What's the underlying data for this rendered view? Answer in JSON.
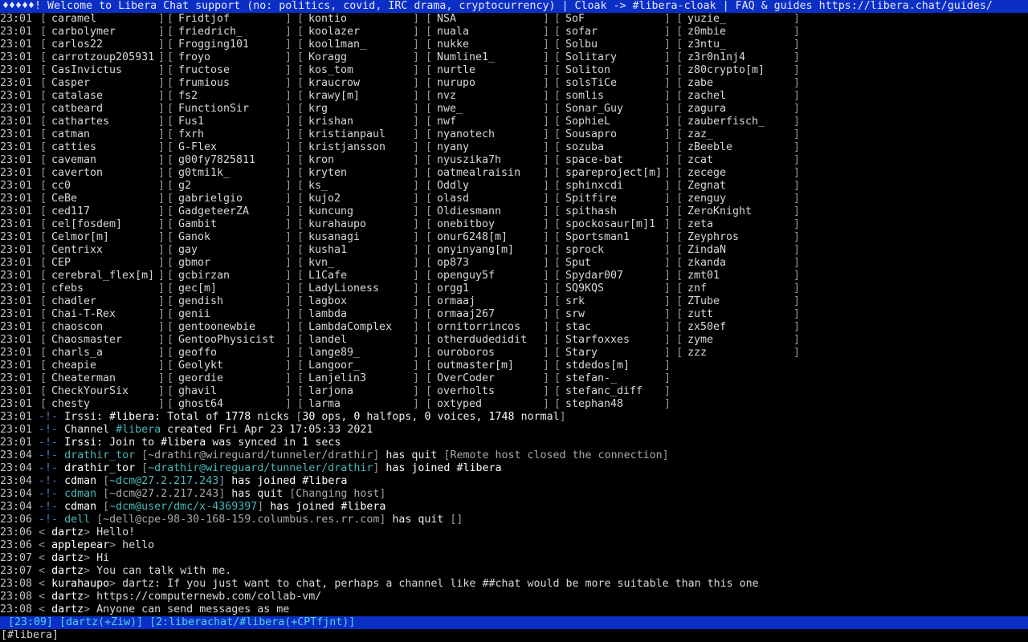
{
  "topic": "♦♦♦♦♦! Welcome to Libera Chat support (no: politics, covid, IRC drama, cryptocurrency) | Cloak -> #libera-cloak | FAQ & guides https://libera.chat/guides/",
  "names_timestamp": "23:01",
  "names": [
    [
      "caramel",
      "Fridtjof",
      "kontio",
      "NSA",
      "SoF",
      "yuzie_"
    ],
    [
      "carbolymer",
      "friedrich_",
      "koolazer",
      "nuala",
      "sofar",
      "z0mbie"
    ],
    [
      "carlos22",
      "Frogging101",
      "kool1man_",
      "nukke",
      "Solbu",
      "z3ntu_"
    ],
    [
      "carrotzoup205931",
      "froyo",
      "Koragg",
      "Numline1_",
      "Solitary",
      "z3r0n1nj4"
    ],
    [
      "CasInvictus",
      "fructose",
      "kos_tom",
      "nurtle",
      "Soliton",
      "z80crypto[m]"
    ],
    [
      "Casper",
      "frumious",
      "kraucrow",
      "nurupo",
      "solsTiCe",
      "zabe"
    ],
    [
      "catalase",
      "fs2",
      "krawy[m]",
      "nvz",
      "somlis",
      "zachel"
    ],
    [
      "catbeard",
      "FunctionSir",
      "krg",
      "nwe_",
      "Sonar_Guy",
      "zagura"
    ],
    [
      "cathartes",
      "Fus1",
      "krishan",
      "nwf",
      "SophieL",
      "zauberfisch_"
    ],
    [
      "catman",
      "fxrh",
      "kristianpaul",
      "nyanotech",
      "Sousapro",
      "zaz_"
    ],
    [
      "catties",
      "G-Flex",
      "kristjansson",
      "nyany",
      "sozuba",
      "zBeeble"
    ],
    [
      "caveman",
      "g00fy7825811",
      "kron",
      "nyuszika7h",
      "space-bat",
      "zcat"
    ],
    [
      "caverton",
      "g0tmi1k_",
      "kryten",
      "oatmealraisin",
      "spareproject[m]",
      "zecege"
    ],
    [
      "cc0",
      "g2",
      "ks_",
      "Oddly",
      "sphinxcdi",
      "Zegnat"
    ],
    [
      "CeBe",
      "gabrielgio",
      "kujo2",
      "olasd",
      "Spitfire",
      "zenguy"
    ],
    [
      "ced117",
      "GadgeteerZA",
      "kuncung",
      "Oldiesmann",
      "spithash",
      "ZeroKnight"
    ],
    [
      "cel[fosdem]",
      "Gambit",
      "kurahaupo",
      "onebitboy",
      "spockosaur[m]1",
      "zeta"
    ],
    [
      "Celmor[m]",
      "Ganok",
      "kusanagi",
      "onur6248[m]",
      "Sportsman1",
      "Zeyphros"
    ],
    [
      "Centrixx",
      "gay",
      "kusha1",
      "onyinyang[m]",
      "sprock",
      "ZindaN"
    ],
    [
      "CEP",
      "gbmor",
      "kvn_",
      "op873",
      "Sput",
      "zkanda"
    ],
    [
      "cerebral_flex[m]",
      "gcbirzan",
      "L1Cafe",
      "openguy5f",
      "Spydar007",
      "zmt01"
    ],
    [
      "cfebs",
      "gec[m]",
      "LadyLioness",
      "orgg1",
      "SQ9KQS",
      "znf"
    ],
    [
      "chadler",
      "gendish",
      "lagbox",
      "ormaaj",
      "srk",
      "ZTube"
    ],
    [
      "Chai-T-Rex",
      "genii",
      "lambda",
      "ormaaj267",
      "srw",
      "zutt"
    ],
    [
      "chaoscon",
      "gentoonewbie",
      "LambdaComplex",
      "ornitorrincos",
      "stac",
      "zx50ef"
    ],
    [
      "Chaosmaster",
      "GentooPhysicist",
      "landel",
      "otherdudedidit",
      "Starfoxxes",
      "zyme"
    ],
    [
      "charls_a",
      "geoffo",
      "lange89_",
      "ouroboros",
      "Stary",
      "zzz"
    ],
    [
      "cheapie",
      "Geolykt",
      "Langoor_",
      "outmaster[m]",
      "stdedos[m]",
      ""
    ],
    [
      "Cheaterman",
      "geordie",
      "Lanjelin3",
      "OverCoder",
      "stefan-_",
      ""
    ],
    [
      "CheckYourSix",
      "ghavil",
      "larjona",
      "overholts",
      "stefanc_diff",
      ""
    ],
    [
      "chesty",
      "ghost64",
      "larma",
      "oxtyped",
      "stephan48",
      ""
    ]
  ],
  "messages": [
    {
      "ts": "23:01",
      "kind": "server",
      "parts": [
        [
          "sys",
          "Irssi: "
        ],
        [
          "white",
          "#libera"
        ],
        [
          "sys",
          ": Total of "
        ],
        [
          "white",
          "1778"
        ],
        [
          "sys",
          " nicks "
        ],
        [
          "br",
          "["
        ],
        [
          "white",
          "30"
        ],
        [
          "sys",
          " ops, "
        ],
        [
          "white",
          "0"
        ],
        [
          "sys",
          " halfops, "
        ],
        [
          "white",
          "0"
        ],
        [
          "sys",
          " voices, "
        ],
        [
          "white",
          "1748"
        ],
        [
          "sys",
          " normal"
        ],
        [
          "br",
          "]"
        ]
      ]
    },
    {
      "ts": "23:01",
      "kind": "server",
      "parts": [
        [
          "sys",
          "Channel "
        ],
        [
          "tealnick",
          "#libera"
        ],
        [
          "sys",
          " created Fri Apr 23 17:05:33 2021"
        ]
      ]
    },
    {
      "ts": "23:01",
      "kind": "server",
      "parts": [
        [
          "white",
          "Irssi: "
        ],
        [
          "sys",
          "Join to "
        ],
        [
          "white",
          "#libera"
        ],
        [
          "sys",
          " was synced in "
        ],
        [
          "white",
          "1"
        ],
        [
          "sys",
          " secs"
        ]
      ]
    },
    {
      "ts": "23:04",
      "kind": "server",
      "parts": [
        [
          "tealnick",
          "drathir_tor"
        ],
        [
          "br",
          " ["
        ],
        [
          "muted",
          "~drathir@wireguard/tunneler/drathir"
        ],
        [
          "br",
          "]"
        ],
        [
          "sys",
          " has quit "
        ],
        [
          "br",
          "["
        ],
        [
          "muted",
          "Remote host closed the connection"
        ],
        [
          "br",
          "]"
        ]
      ]
    },
    {
      "ts": "23:04",
      "kind": "server",
      "parts": [
        [
          "white",
          "drathir_tor"
        ],
        [
          "br",
          " ["
        ],
        [
          "tealhost",
          "~drathir@wireguard/tunneler/drathir"
        ],
        [
          "br",
          "]"
        ],
        [
          "white",
          " has joined "
        ],
        [
          "white",
          "#libera"
        ]
      ]
    },
    {
      "ts": "23:04",
      "kind": "server",
      "parts": [
        [
          "white",
          "cdman"
        ],
        [
          "br",
          " ["
        ],
        [
          "tealhost",
          "~dcm@27.2.217.243"
        ],
        [
          "br",
          "]"
        ],
        [
          "white",
          " has joined "
        ],
        [
          "white",
          "#libera"
        ]
      ]
    },
    {
      "ts": "23:04",
      "kind": "server",
      "parts": [
        [
          "tealnick",
          "cdman"
        ],
        [
          "br",
          " ["
        ],
        [
          "muted",
          "~dcm@27.2.217.243"
        ],
        [
          "br",
          "]"
        ],
        [
          "sys",
          " has quit "
        ],
        [
          "br",
          "["
        ],
        [
          "muted",
          "Changing host"
        ],
        [
          "br",
          "]"
        ]
      ]
    },
    {
      "ts": "23:04",
      "kind": "server",
      "parts": [
        [
          "white",
          "cdman"
        ],
        [
          "br",
          " ["
        ],
        [
          "tealhost",
          "~dcm@user/dmc/x-4369397"
        ],
        [
          "br",
          "]"
        ],
        [
          "white",
          " has joined "
        ],
        [
          "white",
          "#libera"
        ]
      ]
    },
    {
      "ts": "23:06",
      "kind": "server",
      "parts": [
        [
          "tealnick",
          "dell"
        ],
        [
          "br",
          " ["
        ],
        [
          "muted",
          "~dell@cpe-98-30-168-159.columbus.res.rr.com"
        ],
        [
          "br",
          "]"
        ],
        [
          "sys",
          " has quit "
        ],
        [
          "br",
          "[]"
        ]
      ]
    },
    {
      "ts": "23:06",
      "kind": "msg",
      "nick": "dartz",
      "text": "Hello!"
    },
    {
      "ts": "23:06",
      "kind": "msg",
      "nick": "applepear",
      "text": "hello"
    },
    {
      "ts": "23:07",
      "kind": "msg",
      "nick": "dartz",
      "text": "Hi"
    },
    {
      "ts": "23:07",
      "kind": "msg",
      "nick": "dartz",
      "text": "You can talk with me."
    },
    {
      "ts": "23:08",
      "kind": "msg",
      "nick": "kurahaupo",
      "text": "dartz: If you just want to chat, perhaps a channel like ##chat would be more suitable than this one"
    },
    {
      "ts": "23:08",
      "kind": "msg",
      "nick": "dartz",
      "text": "https://computernewb.com/collab-vm/"
    },
    {
      "ts": "23:08",
      "kind": "msg",
      "nick": "dartz",
      "text": "Anyone can send messages as me"
    }
  ],
  "status_bar": "[23:09] [dartz(+Ziw)] [2:liberachat/#libera(+CPTfjnt)]",
  "input_prompt": "[#libera]",
  "colors": {
    "bar_bg": "#0b2fc4",
    "status_text": "#4fd6e6",
    "teal": "#4ab8b8",
    "bang": "#3f7fd0"
  }
}
